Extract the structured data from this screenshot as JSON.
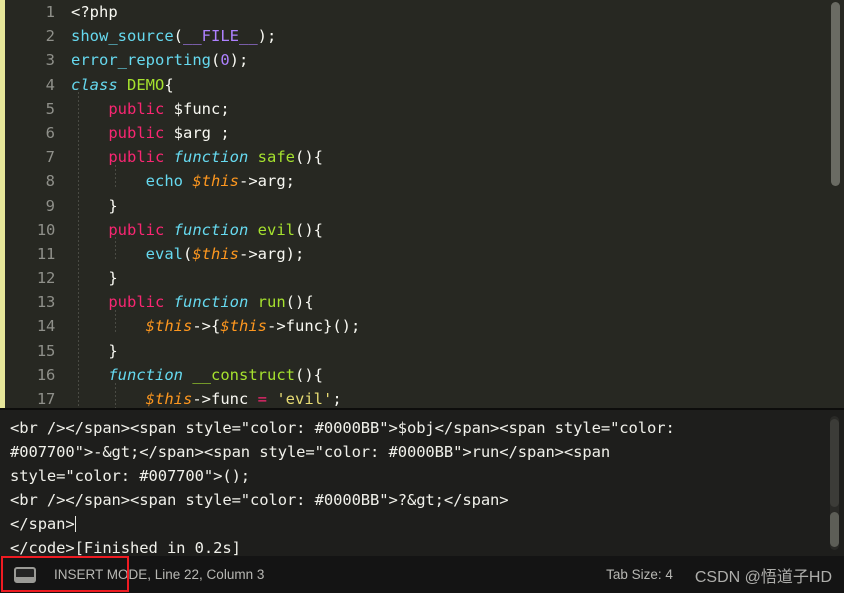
{
  "editor": {
    "language": "php",
    "theme_background": "#272822",
    "lines": [
      {
        "n": "1",
        "tokens": [
          {
            "t": "<?php",
            "c": "t-tag"
          }
        ]
      },
      {
        "n": "2",
        "tokens": [
          {
            "t": "show_source",
            "c": "t-builtin"
          },
          {
            "t": "(",
            "c": "t-punct"
          },
          {
            "t": "__FILE__",
            "c": "t-const"
          },
          {
            "t": ");",
            "c": "t-punct"
          }
        ]
      },
      {
        "n": "3",
        "tokens": [
          {
            "t": "error_reporting",
            "c": "t-builtin"
          },
          {
            "t": "(",
            "c": "t-punct"
          },
          {
            "t": "0",
            "c": "t-num"
          },
          {
            "t": ");",
            "c": "t-punct"
          }
        ]
      },
      {
        "n": "4",
        "tokens": [
          {
            "t": "class",
            "c": "t-kw-it"
          },
          {
            "t": " ",
            "c": "t-punct"
          },
          {
            "t": "DEMO",
            "c": "t-fn"
          },
          {
            "t": "{",
            "c": "t-punct"
          }
        ]
      },
      {
        "n": "5",
        "tokens": [
          {
            "t": "    ",
            "c": "t-punct"
          },
          {
            "t": "public",
            "c": "t-kw"
          },
          {
            "t": " ",
            "c": "t-punct"
          },
          {
            "t": "$func",
            "c": "t-var"
          },
          {
            "t": ";",
            "c": "t-punct"
          }
        ]
      },
      {
        "n": "6",
        "tokens": [
          {
            "t": "    ",
            "c": "t-punct"
          },
          {
            "t": "public",
            "c": "t-kw"
          },
          {
            "t": " ",
            "c": "t-punct"
          },
          {
            "t": "$arg",
            "c": "t-var"
          },
          {
            "t": " ;",
            "c": "t-punct"
          }
        ]
      },
      {
        "n": "7",
        "tokens": [
          {
            "t": "    ",
            "c": "t-punct"
          },
          {
            "t": "public",
            "c": "t-kw"
          },
          {
            "t": " ",
            "c": "t-punct"
          },
          {
            "t": "function",
            "c": "t-kw-it"
          },
          {
            "t": " ",
            "c": "t-punct"
          },
          {
            "t": "safe",
            "c": "t-fn"
          },
          {
            "t": "(){",
            "c": "t-punct"
          }
        ]
      },
      {
        "n": "8",
        "tokens": [
          {
            "t": "        ",
            "c": "t-punct"
          },
          {
            "t": "echo",
            "c": "t-builtin"
          },
          {
            "t": " ",
            "c": "t-punct"
          },
          {
            "t": "$this",
            "c": "t-this"
          },
          {
            "t": "->arg;",
            "c": "t-punct"
          }
        ]
      },
      {
        "n": "9",
        "tokens": [
          {
            "t": "    }",
            "c": "t-punct"
          }
        ]
      },
      {
        "n": "10",
        "tokens": [
          {
            "t": "    ",
            "c": "t-punct"
          },
          {
            "t": "public",
            "c": "t-kw"
          },
          {
            "t": " ",
            "c": "t-punct"
          },
          {
            "t": "function",
            "c": "t-kw-it"
          },
          {
            "t": " ",
            "c": "t-punct"
          },
          {
            "t": "evil",
            "c": "t-fn"
          },
          {
            "t": "(){",
            "c": "t-punct"
          }
        ]
      },
      {
        "n": "11",
        "tokens": [
          {
            "t": "        ",
            "c": "t-punct"
          },
          {
            "t": "eval",
            "c": "t-builtin"
          },
          {
            "t": "(",
            "c": "t-punct"
          },
          {
            "t": "$this",
            "c": "t-this"
          },
          {
            "t": "->arg);",
            "c": "t-punct"
          }
        ]
      },
      {
        "n": "12",
        "tokens": [
          {
            "t": "    }",
            "c": "t-punct"
          }
        ]
      },
      {
        "n": "13",
        "tokens": [
          {
            "t": "    ",
            "c": "t-punct"
          },
          {
            "t": "public",
            "c": "t-kw"
          },
          {
            "t": " ",
            "c": "t-punct"
          },
          {
            "t": "function",
            "c": "t-kw-it"
          },
          {
            "t": " ",
            "c": "t-punct"
          },
          {
            "t": "run",
            "c": "t-fn"
          },
          {
            "t": "(){",
            "c": "t-punct"
          }
        ]
      },
      {
        "n": "14",
        "tokens": [
          {
            "t": "        ",
            "c": "t-punct"
          },
          {
            "t": "$this",
            "c": "t-this"
          },
          {
            "t": "->{",
            "c": "t-punct"
          },
          {
            "t": "$this",
            "c": "t-this"
          },
          {
            "t": "->func}();",
            "c": "t-punct"
          }
        ]
      },
      {
        "n": "15",
        "tokens": [
          {
            "t": "    }",
            "c": "t-punct"
          }
        ]
      },
      {
        "n": "16",
        "tokens": [
          {
            "t": "    ",
            "c": "t-punct"
          },
          {
            "t": "function",
            "c": "t-kw-it"
          },
          {
            "t": " ",
            "c": "t-punct"
          },
          {
            "t": "__construct",
            "c": "t-fn"
          },
          {
            "t": "(){",
            "c": "t-punct"
          }
        ]
      },
      {
        "n": "17",
        "tokens": [
          {
            "t": "        ",
            "c": "t-punct"
          },
          {
            "t": "$this",
            "c": "t-this"
          },
          {
            "t": "->func ",
            "c": "t-punct"
          },
          {
            "t": "=",
            "c": "t-kw"
          },
          {
            "t": " ",
            "c": "t-punct"
          },
          {
            "t": "'evil'",
            "c": "t-str"
          },
          {
            "t": ";",
            "c": "t-punct"
          }
        ]
      }
    ]
  },
  "console": {
    "lines": [
      "<br /></span><span style=\"color: #0000BB\">$obj</span><span style=\"color:",
      "#007700\">-&gt;</span><span style=\"color: #0000BB\">run</span><span",
      "style=\"color: #007700\">();",
      "<br /></span><span style=\"color: #0000BB\">?&gt;</span>",
      "</span>",
      "</code>[Finished in 0.2s]"
    ],
    "caret_line_index": 4
  },
  "statusbar": {
    "icon": "console-icon",
    "status_text": "INSERT MODE, Line 22, Column 3",
    "tab_size_label": "Tab Size: 4",
    "watermark": "CSDN @悟道子HD",
    "annotation_color": "#ee1b22"
  }
}
